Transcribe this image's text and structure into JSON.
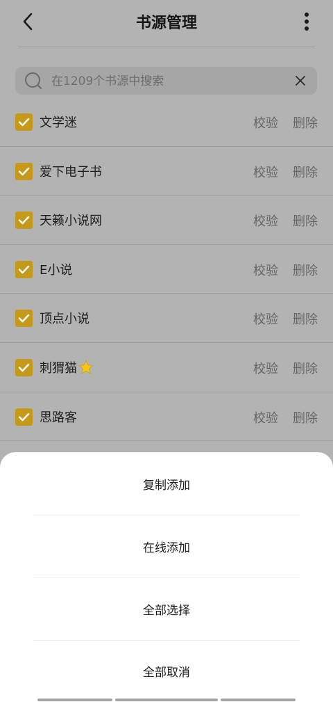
{
  "header": {
    "title": "书源管理",
    "back_icon": "chevron-left-icon",
    "more_icon": "more-vertical-icon"
  },
  "search": {
    "placeholder": "在1209个书源中搜索",
    "value": ""
  },
  "list": {
    "items": [
      {
        "name": "文学迷",
        "checked": true,
        "verify_label": "校验",
        "delete_label": "删除"
      },
      {
        "name": "爱下电子书",
        "checked": true,
        "verify_label": "校验",
        "delete_label": "删除"
      },
      {
        "name": "天籁小说网",
        "checked": true,
        "verify_label": "校验",
        "delete_label": "删除"
      },
      {
        "name": "E小说",
        "checked": true,
        "verify_label": "校验",
        "delete_label": "删除"
      },
      {
        "name": "顶点小说",
        "checked": true,
        "verify_label": "校验",
        "delete_label": "删除"
      },
      {
        "name": "刺猬猫",
        "checked": true,
        "starred": true,
        "verify_label": "校验",
        "delete_label": "删除"
      },
      {
        "name": "思路客",
        "checked": true,
        "verify_label": "校验",
        "delete_label": "删除"
      }
    ]
  },
  "sheet": {
    "items": [
      {
        "label": "复制添加"
      },
      {
        "label": "在线添加"
      },
      {
        "label": "全部选择"
      },
      {
        "label": "全部取消"
      }
    ]
  },
  "colors": {
    "accent": "#c59a1a",
    "overlay": "#b3b3b3",
    "sheet_bg": "#ffffff",
    "star": "#f5c518"
  }
}
